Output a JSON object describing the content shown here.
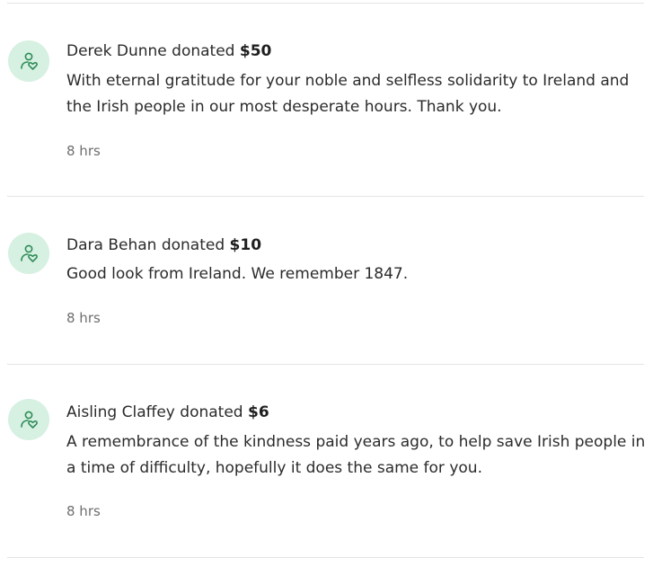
{
  "donations": [
    {
      "donor": "Derek Dunne",
      "verb": "donated",
      "amount": "$50",
      "message": "With eternal gratitude for your noble and selfless solidarity to Ireland and the Irish people in our most desperate hours. Thank you.",
      "time": "8 hrs",
      "icon": "donor-heart-icon"
    },
    {
      "donor": "Dara Behan",
      "verb": "donated",
      "amount": "$10",
      "message": "Good look from Ireland. We remember 1847.",
      "time": "8 hrs",
      "icon": "donor-heart-icon"
    },
    {
      "donor": "Aisling Claffey",
      "verb": "donated",
      "amount": "$6",
      "message": "A remembrance of the kindness paid years ago, to help save Irish people in a time of difficulty, hopefully it does the same for you.",
      "time": "8 hrs",
      "icon": "donor-heart-icon"
    }
  ],
  "colors": {
    "avatar_bg": "#d6f0e2",
    "icon_stroke": "#2e8b57",
    "divider": "#e4e4e4",
    "muted_text": "#6f6f6f"
  }
}
